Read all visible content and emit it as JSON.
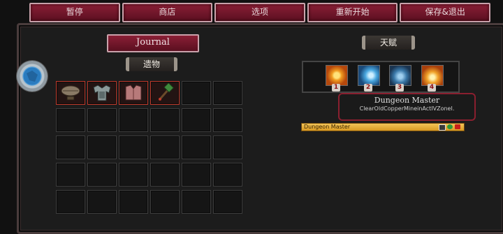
{
  "top_menu": {
    "pause": "暂停",
    "shop": "商店",
    "options": "选项",
    "restart": "重新开始",
    "save_quit": "保存&退出"
  },
  "journal": {
    "title": "Journal"
  },
  "relics": {
    "label": "遗物",
    "items": [
      "zeppelin",
      "armor",
      "vest",
      "hammer"
    ]
  },
  "talents": {
    "label": "天赋",
    "slots": [
      {
        "number": "1",
        "color": "#e07a12"
      },
      {
        "number": "2",
        "color": "#2b86c8"
      },
      {
        "number": "3",
        "color": "#3c6f9a"
      },
      {
        "number": "4",
        "color": "#e58a1a"
      }
    ]
  },
  "tooltip": {
    "title": "Dungeon Master",
    "description": "ClearOldCopperMineinActIVZoneI."
  },
  "quest_bar": {
    "label": "Dungeon Master"
  },
  "colors": {
    "button": "#7a1a30",
    "slot_selected_border": "#c0392b",
    "quest_bar": "#e8b040"
  }
}
